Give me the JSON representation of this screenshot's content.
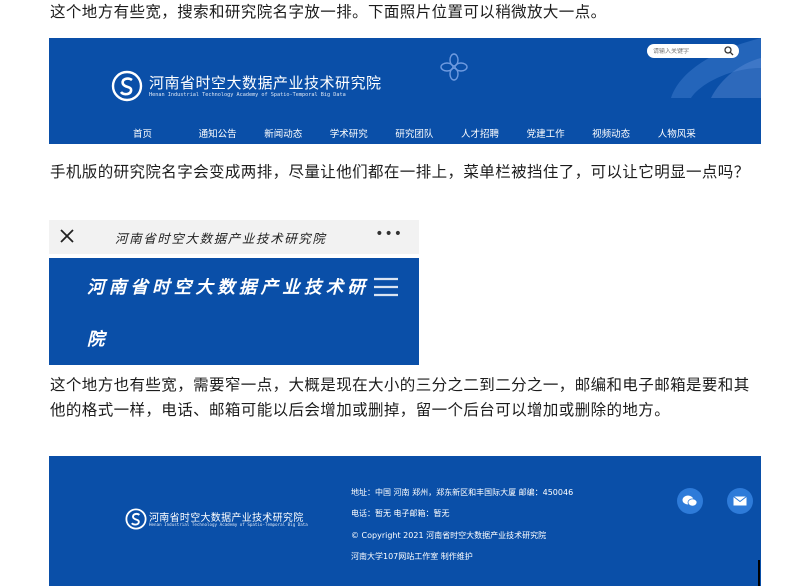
{
  "paragraphs": {
    "p1": "这个地方有些宽，搜索和研究院名字放一排。下面照片位置可以稍微放大一点。",
    "p2": "手机版的研究院名字会变成两排，尽量让他们都在一排上，菜单栏被挡住了，可以让它明显一点吗？",
    "p3": "这个地方也有些宽，需要窄一点，大概是现在大小的三分之二到二分之一，邮编和电子邮箱是要和其他的格式一样，电话、邮箱可能以后会增加或删掉，留一个后台可以增加或删除的地方。"
  },
  "desktop_header": {
    "search_placeholder": "请输入关键字",
    "title": "河南省时空大数据产业技术研究院",
    "subtitle": "Henan Industrial Technology Academy of Spatio-Temporal Big Data",
    "nav": [
      "首页",
      "通知公告",
      "新闻动态",
      "学术研究",
      "研究团队",
      "人才招聘",
      "党建工作",
      "视频动态",
      "人物风采"
    ]
  },
  "mobile": {
    "bar_title": "河南省时空大数据产业技术研究院",
    "line1": "河南省时空大数据产业技术研",
    "line2": "院"
  },
  "footer": {
    "title": "河南省时空大数据产业技术研究院",
    "subtitle": "Henan Industrial Technology Academy of Spatio-Temporal Big Data",
    "address": "地址：中国 河南 郑州，郑东新区和丰国际大厦 邮编：450046",
    "contact": "电话：暂无 电子邮箱：暂无",
    "copyright": "© Copyright 2021 河南省时空大数据产业技术研究院",
    "maintainer": "河南大学107网站工作室 制作维护"
  },
  "colors": {
    "brand_blue": "#0a4fa8",
    "icon_blue": "#2e7bd9"
  },
  "icons": [
    "search-icon",
    "logo-icon",
    "close-icon",
    "more-icon",
    "menu-icon",
    "wechat-icon",
    "mail-icon"
  ]
}
